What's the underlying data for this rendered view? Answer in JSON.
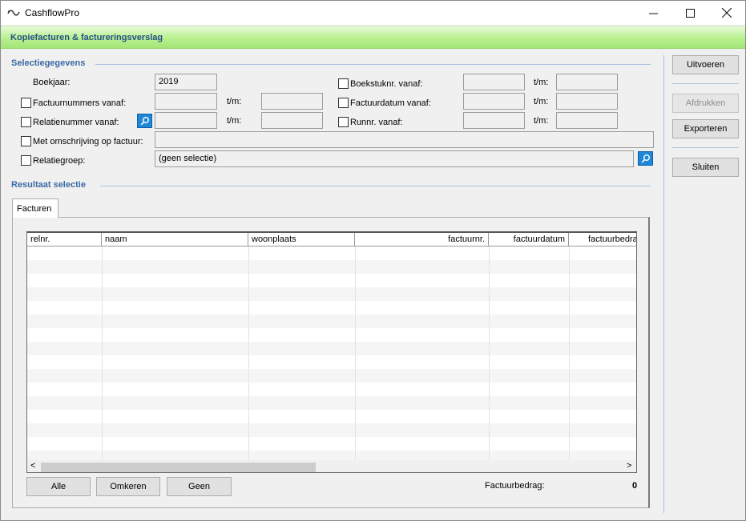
{
  "window": {
    "app_title": "CashflowPro",
    "minimize": "—",
    "maximize": "☐",
    "close": "✕"
  },
  "banner": {
    "title": "Kopiefacturen & factureringsverslag"
  },
  "selection": {
    "title": "Selectiegegevens",
    "boekjaar_label": "Boekjaar:",
    "boekjaar_value": "2019",
    "factuurnummers_label": "Factuurnummers vanaf:",
    "relatienummer_label": "Relatienummer vanaf:",
    "omschrijving_label": "Met omschrijving op factuur:",
    "relatiegroep_label": "Relatiegroep:",
    "relatiegroep_value": "(geen selectie)",
    "boekstuknr_label": "Boekstuknr. vanaf:",
    "factuurdatum_label": "Factuurdatum vanaf:",
    "runnr_label": "Runnr. vanaf:",
    "tm_label": "t/m:"
  },
  "result": {
    "title": "Resultaat selectie",
    "tab_label": "Facturen",
    "columns": [
      "relnr.",
      "naam",
      "woonplaats",
      "factuurnr.",
      "factuurdatum",
      "factuurbedrag"
    ],
    "buttons": {
      "alle": "Alle",
      "omkeren": "Omkeren",
      "geen": "Geen"
    },
    "total_label": "Factuurbedrag:",
    "total_value": "0",
    "scroll_left": "<",
    "scroll_right": ">"
  },
  "actions": {
    "uitvoeren": "Uitvoeren",
    "afdrukken": "Afdrukken",
    "exporteren": "Exporteren",
    "sluiten": "Sluiten"
  },
  "colors": {
    "accent": "#3a6aa5",
    "banner_green": "#b9f08f",
    "search_blue": "#1f86d8"
  }
}
